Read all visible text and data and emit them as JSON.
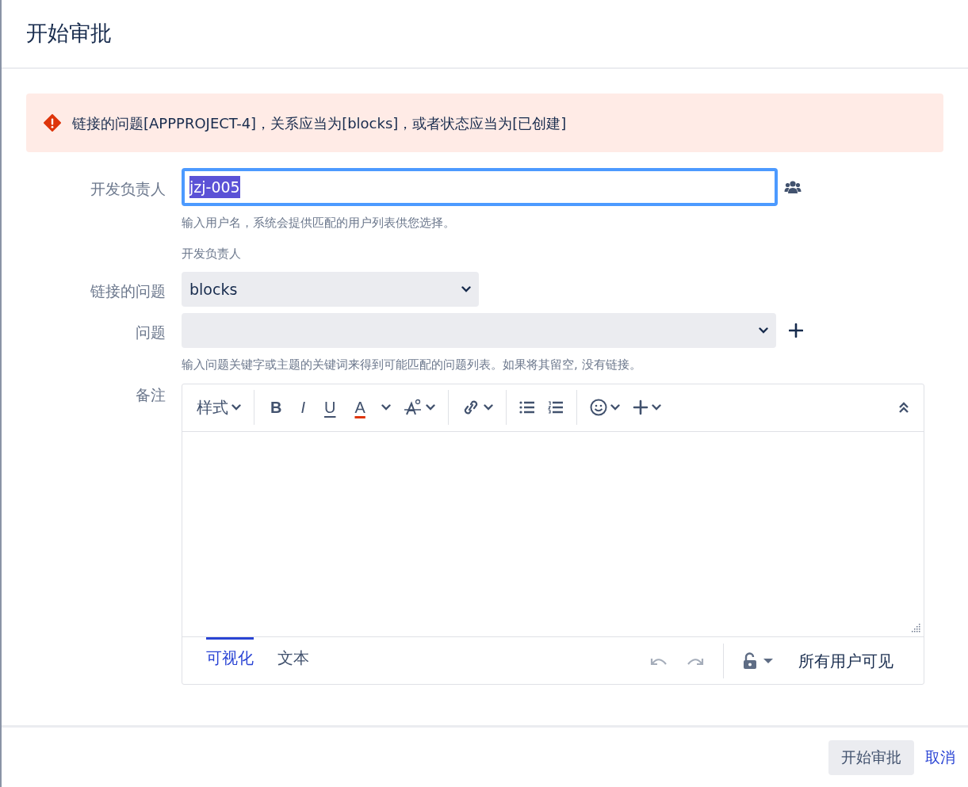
{
  "dialog": {
    "title": "开始审批"
  },
  "alert": {
    "text": "链接的问题[APPPROJECT-4]，关系应当为[blocks]，或者状态应当为[已创建]"
  },
  "fields": [
    {
      "kind": "user",
      "label": "开发负责人",
      "value": "jzj-005",
      "focused": true,
      "help": [
        "输入用户名，系统会提供匹配的用户列表供您选择。",
        "开发负责人"
      ]
    },
    {
      "kind": "select",
      "label": "链接的问题",
      "value": "blocks"
    },
    {
      "kind": "issue",
      "label": "问题",
      "help": [
        "输入问题关键字或主题的关键词来得到可能匹配的问题列表。如果将其留空, 没有链接。"
      ]
    },
    {
      "kind": "editor",
      "label": "备注",
      "style_menu": "样式",
      "glyphs": [
        "B",
        "I",
        "U",
        "A"
      ],
      "tabs": [
        {
          "label": "可视化",
          "selected": true
        },
        {
          "label": "文本",
          "selected": false
        }
      ],
      "visibility": "所有用户可见"
    }
  ],
  "buttons": [
    {
      "kind": "primary",
      "label": "开始审批"
    },
    {
      "kind": "link",
      "label": "取消"
    }
  ]
}
